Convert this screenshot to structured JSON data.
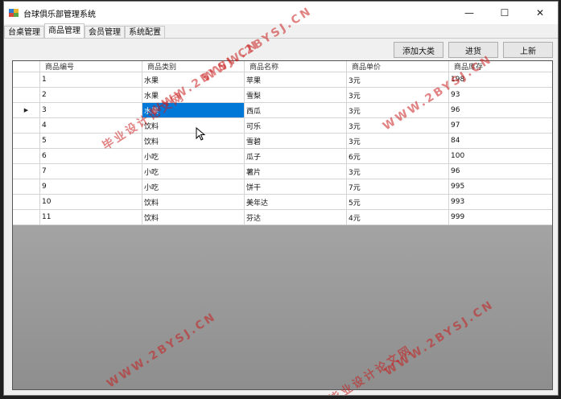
{
  "window": {
    "title": "台球俱乐部管理系统",
    "controls": {
      "minimize": "—",
      "maximize": "☐",
      "close": "✕"
    }
  },
  "tabs": [
    {
      "label": "台桌管理",
      "active": false
    },
    {
      "label": "商品管理",
      "active": true
    },
    {
      "label": "会员管理",
      "active": false
    },
    {
      "label": "系统配置",
      "active": false
    }
  ],
  "toolbar": {
    "add_category": "添加大类",
    "restock": "进货",
    "new_arrival": "上新"
  },
  "grid": {
    "columns": [
      "商品编号",
      "商品类别",
      "商品名称",
      "商品单价",
      "商品库存"
    ],
    "rows": [
      {
        "id": "1",
        "category": "水果",
        "name": "苹果",
        "price": "3元",
        "stock": "198"
      },
      {
        "id": "2",
        "category": "水果",
        "name": "雪梨",
        "price": "3元",
        "stock": "93"
      },
      {
        "id": "3",
        "category": "水果",
        "name": "西瓜",
        "price": "3元",
        "stock": "96"
      },
      {
        "id": "4",
        "category": "饮料",
        "name": "可乐",
        "price": "3元",
        "stock": "97"
      },
      {
        "id": "5",
        "category": "饮料",
        "name": "雪碧",
        "price": "3元",
        "stock": "84"
      },
      {
        "id": "6",
        "category": "小吃",
        "name": "瓜子",
        "price": "6元",
        "stock": "100"
      },
      {
        "id": "7",
        "category": "小吃",
        "name": "薯片",
        "price": "3元",
        "stock": "96"
      },
      {
        "id": "9",
        "category": "小吃",
        "name": "饼干",
        "price": "7元",
        "stock": "995"
      },
      {
        "id": "10",
        "category": "饮料",
        "name": "美年达",
        "price": "5元",
        "stock": "993"
      },
      {
        "id": "11",
        "category": "饮料",
        "name": "芬达",
        "price": "4元",
        "stock": "999"
      }
    ],
    "current_row_index": 2,
    "selected_cell": "category",
    "current_row_marker": "▶"
  },
  "watermarks": {
    "site": "WWW.2BYSJ.CN",
    "brand": "毕业设计论文网"
  },
  "colors": {
    "selection": "#0078d7",
    "watermark": "#c81e1e"
  }
}
